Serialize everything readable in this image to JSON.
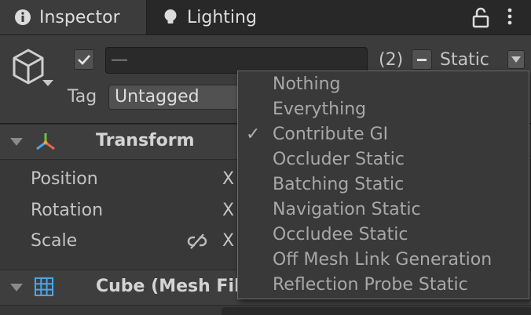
{
  "tabs": [
    {
      "label": "Inspector",
      "icon": "info-icon",
      "active": true
    },
    {
      "label": "Lighting",
      "icon": "lightbulb-icon",
      "active": false
    }
  ],
  "header": {
    "name_value": "—",
    "object_count": "(2)",
    "static_label": "Static",
    "tag_label": "Tag",
    "tag_value": "Untagged"
  },
  "components": [
    {
      "title": "Transform",
      "properties": [
        {
          "label": "Position",
          "axis": "X"
        },
        {
          "label": "Rotation",
          "axis": "X"
        },
        {
          "label": "Scale",
          "axis": "X"
        }
      ]
    },
    {
      "title": "Cube (Mesh Filt"
    }
  ],
  "static_menu": {
    "items": [
      {
        "label": "Nothing",
        "checked": false
      },
      {
        "label": "Everything",
        "checked": false
      },
      {
        "label": "Contribute GI",
        "checked": true
      },
      {
        "label": "Occluder Static",
        "checked": false
      },
      {
        "label": "Batching Static",
        "checked": false
      },
      {
        "label": "Navigation Static",
        "checked": false
      },
      {
        "label": "Occludee Static",
        "checked": false
      },
      {
        "label": "Off Mesh Link Generation",
        "checked": false
      },
      {
        "label": "Reflection Probe Static",
        "checked": false
      }
    ],
    "check_glyph": "✓"
  },
  "colors": {
    "background": "#383838",
    "tabbar": "#282828",
    "menu_background": "#393939",
    "menu_border": "#6b6b6b"
  }
}
